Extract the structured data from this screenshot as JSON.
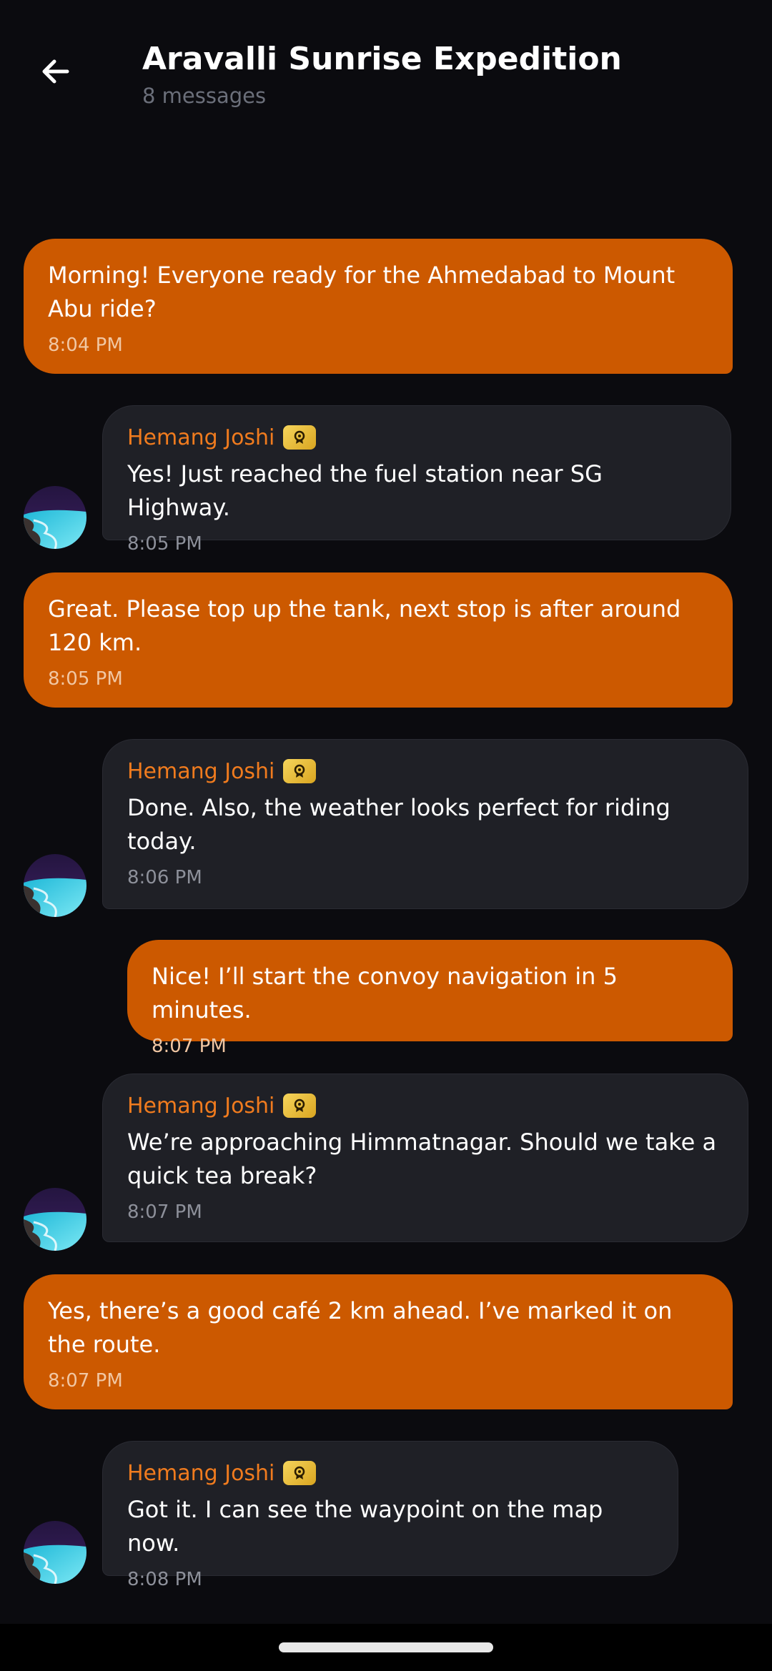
{
  "header": {
    "title": "Aravalli Sunrise Expedition",
    "subtitle": "8 messages",
    "back_icon": "arrow-left-icon"
  },
  "colors": {
    "background": "#0b0b0f",
    "outgoing_bubble": "#cc5900",
    "incoming_bubble": "#1f2026",
    "sender_name": "#f07b1e",
    "badge": "#e6b530"
  },
  "messages": [
    {
      "type": "outgoing",
      "text": "Morning! Everyone ready for the Ahmedabad to Mount Abu ride?",
      "time": "8:04 PM"
    },
    {
      "type": "incoming",
      "sender": "Hemang Joshi",
      "badge_icon": "award-badge-icon",
      "text": "Yes! Just reached the fuel station near SG Highway.",
      "time": "8:05 PM"
    },
    {
      "type": "outgoing",
      "text": "Great. Please top up the tank, next stop is after around 120 km.",
      "time": "8:05 PM"
    },
    {
      "type": "incoming",
      "sender": "Hemang Joshi",
      "badge_icon": "award-badge-icon",
      "text": "Done. Also, the weather looks perfect for riding today.",
      "time": "8:06 PM"
    },
    {
      "type": "outgoing",
      "text": "Nice! I’ll start the convoy navigation in 5 minutes.",
      "time": "8:07 PM"
    },
    {
      "type": "incoming",
      "sender": "Hemang Joshi",
      "badge_icon": "award-badge-icon",
      "text": "We’re approaching Himmatnagar. Should we take a quick tea break?",
      "time": "8:07 PM"
    },
    {
      "type": "outgoing",
      "text": "Yes, there’s a good café 2 km ahead. I’ve marked it on the route.",
      "time": "8:07 PM"
    },
    {
      "type": "incoming",
      "sender": "Hemang Joshi",
      "badge_icon": "award-badge-icon",
      "text": "Got it. I can see the waypoint on the map now.",
      "time": "8:08 PM"
    }
  ]
}
